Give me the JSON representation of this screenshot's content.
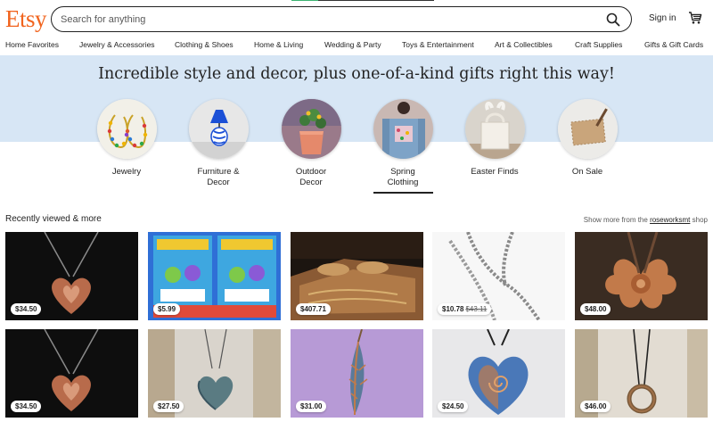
{
  "header": {
    "logo": "Etsy",
    "search_placeholder": "Search for anything",
    "sign_in": "Sign in"
  },
  "nav": [
    "Home Favorites",
    "Jewelry & Accessories",
    "Clothing & Shoes",
    "Home & Living",
    "Wedding & Party",
    "Toys & Entertainment",
    "Art & Collectibles",
    "Craft Supplies",
    "Gifts & Gift Cards"
  ],
  "hero": {
    "title": "Incredible style and decor, plus one-of-a-kind gifts right this way!"
  },
  "categories": [
    {
      "line1": "Jewelry",
      "line2": ""
    },
    {
      "line1": "Furniture &",
      "line2": "Decor"
    },
    {
      "line1": "Outdoor",
      "line2": "Decor"
    },
    {
      "line1": "Spring",
      "line2": "Clothing"
    },
    {
      "line1": "Easter Finds",
      "line2": ""
    },
    {
      "line1": "On Sale",
      "line2": ""
    }
  ],
  "recent": {
    "title": "Recently viewed & more",
    "show_more_prefix": "Show more from the",
    "shop_name": "roseworksmt",
    "show_more_suffix": "shop"
  },
  "listings": [
    {
      "price": "$34.50",
      "original_price": ""
    },
    {
      "price": "$5.99",
      "original_price": ""
    },
    {
      "price": "$407.71",
      "original_price": ""
    },
    {
      "price": "$10.78",
      "original_price": "$43.11"
    },
    {
      "price": "$48.00",
      "original_price": ""
    },
    {
      "price": "$34.50",
      "original_price": ""
    },
    {
      "price": "$27.50",
      "original_price": ""
    },
    {
      "price": "$31.00",
      "original_price": ""
    },
    {
      "price": "$24.50",
      "original_price": ""
    },
    {
      "price": "$46.00",
      "original_price": ""
    }
  ],
  "colors": {
    "brand": "#f1641e",
    "hero_bg": "#d7e6f5",
    "text": "#222222"
  }
}
